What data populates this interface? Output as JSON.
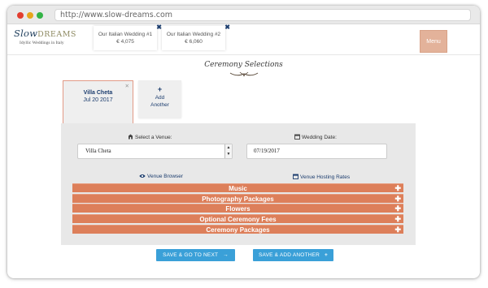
{
  "browser": {
    "url": "http://www.slow-dreams.com"
  },
  "logo": {
    "text_main": "Slow",
    "text_caps": "DREAMS",
    "tagline": "Idyllic Weddings in Italy"
  },
  "wedding_tabs": [
    {
      "name": "Our Italian Wedding #1",
      "price": "€ 4,075"
    },
    {
      "name": "Our Italian Wedding #2",
      "price": "€ 6,060"
    }
  ],
  "header": {
    "menu_label": "Menu"
  },
  "section": {
    "title": "Ceremony Selections"
  },
  "venue_cards": [
    {
      "name": "Villa Cheta",
      "date": "Jul 20 2017"
    }
  ],
  "add_card": {
    "plus": "+",
    "label_line1": "Add",
    "label_line2": "Another"
  },
  "form": {
    "venue_label": "Select a Venue:",
    "venue_value": "Villa Cheta",
    "date_label": "Wedding Date:",
    "date_value": "07/19/2017",
    "venue_browser_link": "Venue Browser",
    "hosting_rates_link": "Venue Hosting Rates"
  },
  "accordion": [
    {
      "label": "Music"
    },
    {
      "label": "Photography Packages"
    },
    {
      "label": "Flowers"
    },
    {
      "label": "Optional Ceremony Fees"
    },
    {
      "label": "Ceremony Packages"
    }
  ],
  "buttons": {
    "save_next": "SAVE & GO TO NEXT",
    "save_add": "SAVE & ADD ANOTHER",
    "next_icon": "→",
    "add_icon": "+"
  },
  "colors": {
    "accent_orange": "#dd7f5a",
    "button_blue": "#3aa0d8",
    "menu_bg": "#e3b29a",
    "navy": "#1c3d6e"
  }
}
